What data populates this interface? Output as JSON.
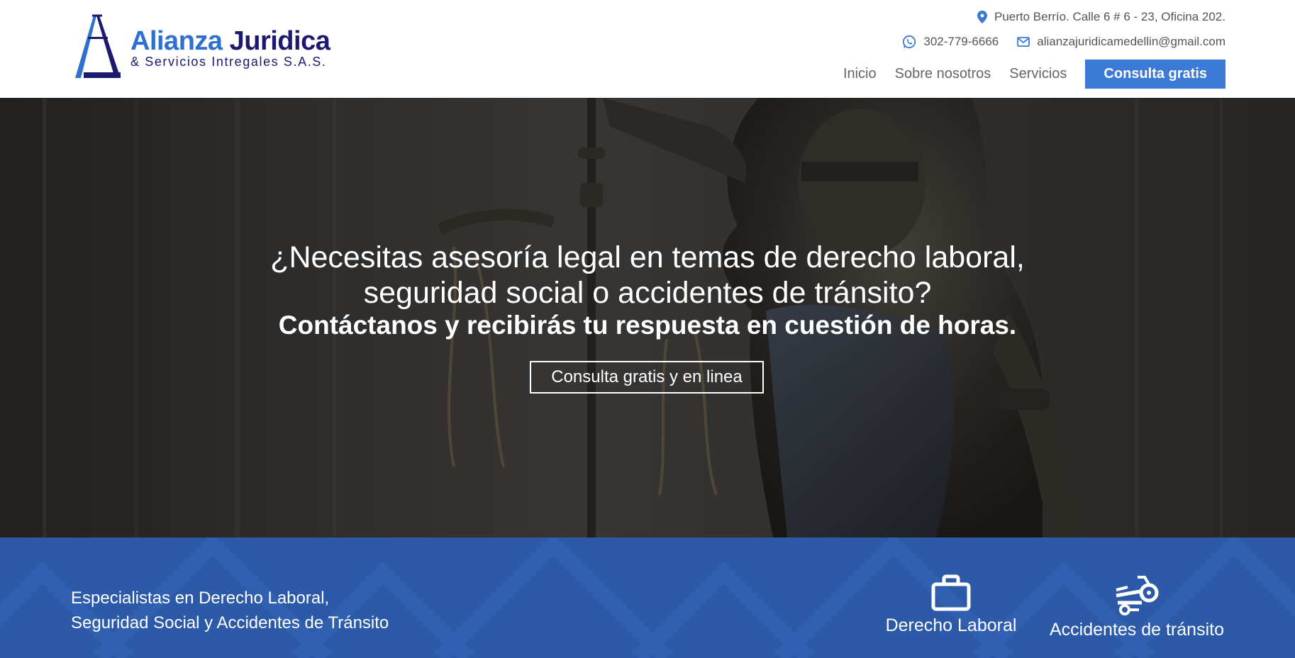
{
  "header": {
    "logo": {
      "name_part1": "Alianza",
      "name_part2": "Juridica",
      "subtitle": "& Servicios Intregales S.A.S.",
      "icon": "triangle-logo-icon"
    },
    "contact": {
      "address": "Puerto Berrío. Calle 6 # 6 - 23, Oficina 202.",
      "address_icon": "map-pin-icon",
      "phone": "302-779-6666",
      "phone_icon": "whatsapp-icon",
      "email": "alianzajuridicamedellin@gmail.com",
      "email_icon": "mail-icon"
    },
    "nav": {
      "items": [
        "Inicio",
        "Sobre nosotros",
        "Servicios"
      ],
      "cta": "Consulta gratis"
    }
  },
  "hero": {
    "line1": "¿Necesitas asesoría legal en temas de derecho laboral,",
    "line2": "seguridad social o accidentes de tránsito?",
    "subtitle": "Contáctanos y recibirás tu respuesta en cuestión de horas.",
    "button": "Consulta gratis y en linea"
  },
  "band": {
    "line1": "Especialistas en Derecho Laboral,",
    "line2": "Seguridad Social y Accidentes de Tránsito",
    "services": [
      {
        "label": "Derecho Laboral",
        "icon": "briefcase-icon"
      },
      {
        "label": "Accidentes de tránsito",
        "icon": "motorcycle-accident-icon"
      }
    ]
  },
  "colors": {
    "brand_blue": "#3b7ad6",
    "brand_navy": "#1c1a70",
    "band_blue": "#2c5aa8"
  }
}
